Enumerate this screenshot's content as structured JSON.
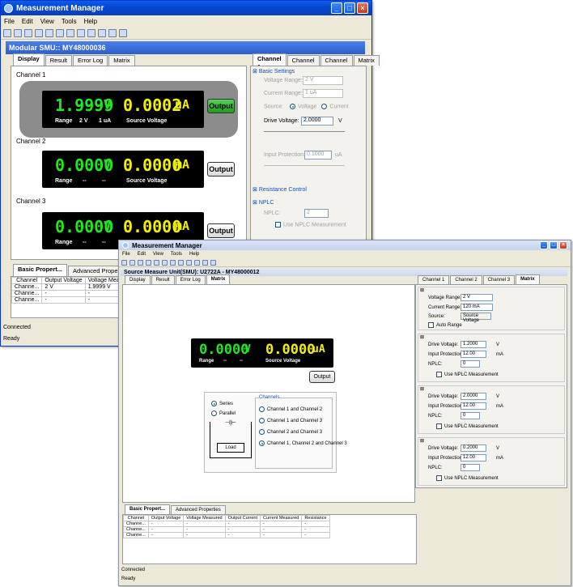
{
  "back": {
    "title": "Measurement Manager",
    "menu": [
      "File",
      "Edit",
      "View",
      "Tools",
      "Help"
    ],
    "child_title": "Modular SMU:: MY48000036",
    "tabs": [
      "Display",
      "Result",
      "Error Log",
      "Matrix"
    ],
    "channel_labels": [
      "Channel 1",
      "Channel 2",
      "Channel 3"
    ],
    "ch1": {
      "voltage": "1.9999",
      "v_unit": "V",
      "current": "0.0002",
      "c_unit": "uA",
      "range": "Range",
      "range_v": "2 V",
      "range_c": "1 uA",
      "source": "Source Voltage",
      "button": "Output"
    },
    "ch2": {
      "voltage": "0.0000",
      "v_unit": "V",
      "current": "0.0000",
      "c_unit": "mA",
      "range": "Range",
      "range_v": "--",
      "range_c": "--",
      "source": "Source Voltage",
      "button": "Output"
    },
    "ch3": {
      "voltage": "0.0000",
      "v_unit": "V",
      "current": "0.0000",
      "c_unit": "mA",
      "range": "Range",
      "range_v": "--",
      "range_c": "--",
      "button": "Output"
    },
    "right_tabs": [
      "Channel 1",
      "Channel 2",
      "Channel 3",
      "Matrix"
    ],
    "basic_settings": "Basic Settings",
    "voltage_range_label": "Voltage Range:",
    "voltage_range": "2 V",
    "current_range_label": "Current Range:",
    "current_range": "1 uA",
    "source_label": "Source:",
    "source_voltage": "Voltage",
    "source_current": "Current",
    "drive_voltage_label": "Drive Voltage:",
    "drive_voltage": "2.0000",
    "drive_voltage_unit": "V",
    "input_protection_label": "Input Protection:",
    "input_protection": "0.1000",
    "input_protection_unit": "uA",
    "resistance_control": "Resistance Control",
    "nplc_header": "NPLC",
    "nplc_label": "NPLC:",
    "nplc_value": "2",
    "use_nplc": "Use NPLC Measurement",
    "bottom_tabs": [
      "Basic Propert...",
      "Advanced Properties"
    ],
    "table_headers": [
      "Channel",
      "Output Voltage",
      "Voltage Measur"
    ],
    "table_rows": [
      [
        "Channe...",
        "2 V",
        "1.9999 V"
      ],
      [
        "Channe...",
        "-",
        "-"
      ],
      [
        "Channe...",
        "-",
        "-"
      ]
    ],
    "status_connected": "Connected",
    "status_ready": "Ready"
  },
  "front": {
    "title": "Measurement Manager",
    "menu": [
      "File",
      "Edit",
      "View",
      "Tools",
      "Help"
    ],
    "child_title": "Source Measure Unit(SMU): U2722A - MY48000012",
    "tabs": [
      "Display",
      "Result",
      "Error Log",
      "Matrix"
    ],
    "lcd": {
      "voltage": "0.0000",
      "v_unit": "V",
      "current": "0.0000",
      "c_unit": "uA",
      "range": "Range",
      "range_v": "--",
      "range_c": "--",
      "source": "Source Voltage"
    },
    "output_button": "Output",
    "series": "Series",
    "parallel": "Parallel",
    "load": "Load",
    "channels_group": "Channels",
    "channel_options": [
      "Channel 1 and Channel 2",
      "Channel 1 and Channel 3",
      "Channel 2 and Channel 3",
      "Channel 1, Channel 2 and Channel 3"
    ],
    "right_tabs": [
      "Channel 1",
      "Channel 2",
      "Channel 3",
      "Matrix"
    ],
    "voltage_range_label": "Voltage Range:",
    "voltage_range": "2 V",
    "current_range_label": "Current Range:",
    "current_range": "120 mA",
    "source_label": "Source:",
    "source_value": "Source Voltage",
    "auto_range": "Auto Range",
    "groups": [
      {
        "drive_label": "Drive Voltage:",
        "drive": "1.2000",
        "drive_unit": "V",
        "prot_label": "Input Protection:",
        "prot": "12.00",
        "prot_unit": "mA",
        "nplc_label": "NPLC:",
        "nplc": "0",
        "use_nplc": "Use NPLC Measurement"
      },
      {
        "drive_label": "Drive Voltage:",
        "drive": "2.0000",
        "drive_unit": "V",
        "prot_label": "Input Protection:",
        "prot": "12.00",
        "prot_unit": "mA",
        "nplc_label": "NPLC:",
        "nplc": "0",
        "use_nplc": "Use NPLC Measurement"
      },
      {
        "drive_label": "Drive Voltage:",
        "drive": "0.2000",
        "drive_unit": "V",
        "prot_label": "Input Protection:",
        "prot": "12.00",
        "prot_unit": "mA",
        "nplc_label": "NPLC:",
        "nplc": "0",
        "use_nplc": "Use NPLC Measurement"
      }
    ],
    "bottom_tabs": [
      "Basic Propert...",
      "Advanced Properties"
    ],
    "table_headers": [
      "Channel",
      "Output Voltage",
      "Voltage Measured",
      "Output Current",
      "Current Measured",
      "Resistance"
    ],
    "table_rows": [
      [
        "Channe...",
        "-",
        "-",
        "-",
        "-",
        "-"
      ],
      [
        "Channe...",
        "-",
        "-",
        "-",
        "-",
        "-"
      ],
      [
        "Channe...",
        "-",
        "-",
        "-",
        "-",
        "-"
      ]
    ],
    "status_connected": "Connected",
    "status_ready": "Ready"
  }
}
